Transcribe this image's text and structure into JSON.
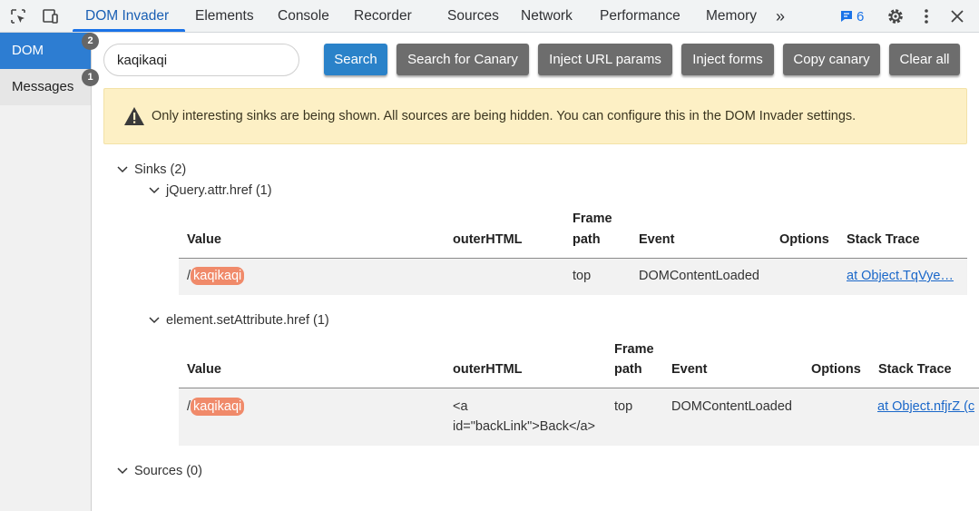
{
  "devtools": {
    "tabs": [
      {
        "label": "DOM Invader",
        "active": true
      },
      {
        "label": "Elements"
      },
      {
        "label": "Console"
      },
      {
        "label": "Recorder"
      },
      {
        "label": "Sources"
      },
      {
        "label": "Network"
      },
      {
        "label": "Performance"
      },
      {
        "label": "Memory"
      }
    ],
    "more_tabs_glyph": "»",
    "issues_count": "6",
    "icons": [
      "inspect-element-icon",
      "device-toolbar-icon",
      "chat-icon",
      "gear-icon",
      "more-vertical-icon",
      "close-icon"
    ]
  },
  "sidebar": {
    "items": [
      {
        "label": "DOM",
        "badge": "2",
        "active": true
      },
      {
        "label": "Messages",
        "badge": "1",
        "active": false
      }
    ]
  },
  "search": {
    "value": "kaqikaqi",
    "placeholder": ""
  },
  "toolbar": {
    "search_label": "Search",
    "canary_label": "Search for Canary",
    "inject_url_label": "Inject URL params",
    "inject_forms_label": "Inject forms",
    "copy_canary_label": "Copy canary",
    "clear_label": "Clear all"
  },
  "warning": {
    "text": "Only interesting sinks are being shown. All sources are being hidden. You can configure this in the DOM Invader settings.",
    "icon": "warning-triangle-icon"
  },
  "tree": {
    "sinks_label": "Sinks (2)",
    "sources_label": "Sources (0)",
    "sinks": [
      {
        "name": "jQuery.attr.href (1)",
        "columns": {
          "value": "Value",
          "outer": "outerHTML",
          "frame1": "Frame",
          "frame2": "path",
          "event": "Event",
          "options": "Options",
          "stack": "Stack Trace"
        },
        "rows": [
          {
            "prefix": "/",
            "canary": "kaqikaqi",
            "outer_line1": "",
            "outer_line2": "",
            "frame": "top",
            "event": "DOMContentLoaded",
            "options": "",
            "stack": "at Object.TqVye…"
          }
        ]
      },
      {
        "name": "element.setAttribute.href (1)",
        "columns": {
          "value": "Value",
          "outer": "outerHTML",
          "frame1": "Frame",
          "frame2": "path",
          "event": "Event",
          "options": "Options",
          "stack": "Stack Trace"
        },
        "rows": [
          {
            "prefix": "/",
            "canary": "kaqikaqi",
            "outer_line1": "<a",
            "outer_line2": "id=\"backLink\">Back</a>",
            "frame": "top",
            "event": "DOMContentLoaded",
            "options": "",
            "stack": "at Object.nfjrZ (c"
          }
        ]
      }
    ]
  },
  "colors": {
    "accent": "#1a73e8",
    "primary_button": "#2a82c9",
    "secondary_button": "#6d6d6d",
    "canary_highlight": "#f08a6a",
    "warning_bg": "#fdf0c5"
  }
}
